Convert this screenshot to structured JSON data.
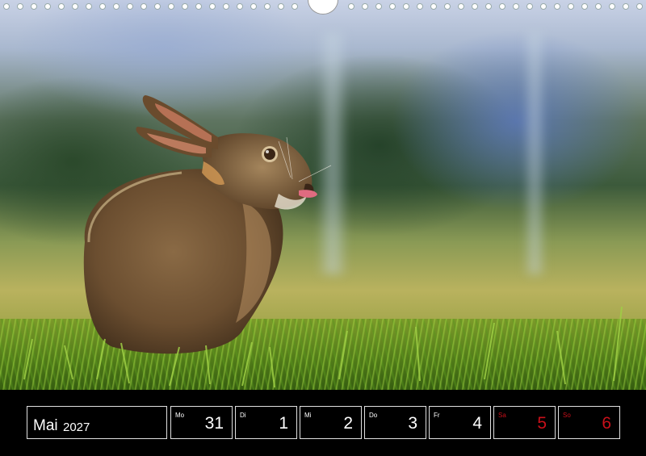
{
  "calendar": {
    "month": "Mai",
    "year": "2027",
    "days": [
      {
        "abbr": "Mo",
        "num": "31",
        "weekend": false
      },
      {
        "abbr": "Di",
        "num": "1",
        "weekend": false
      },
      {
        "abbr": "Mi",
        "num": "2",
        "weekend": false
      },
      {
        "abbr": "Do",
        "num": "3",
        "weekend": false
      },
      {
        "abbr": "Fr",
        "num": "4",
        "weekend": false
      },
      {
        "abbr": "Sa",
        "num": "5",
        "weekend": true
      },
      {
        "abbr": "So",
        "num": "6",
        "weekend": true
      }
    ],
    "weekend_color": "#c8101a"
  },
  "photo": {
    "subject_icon": "hare-icon"
  }
}
